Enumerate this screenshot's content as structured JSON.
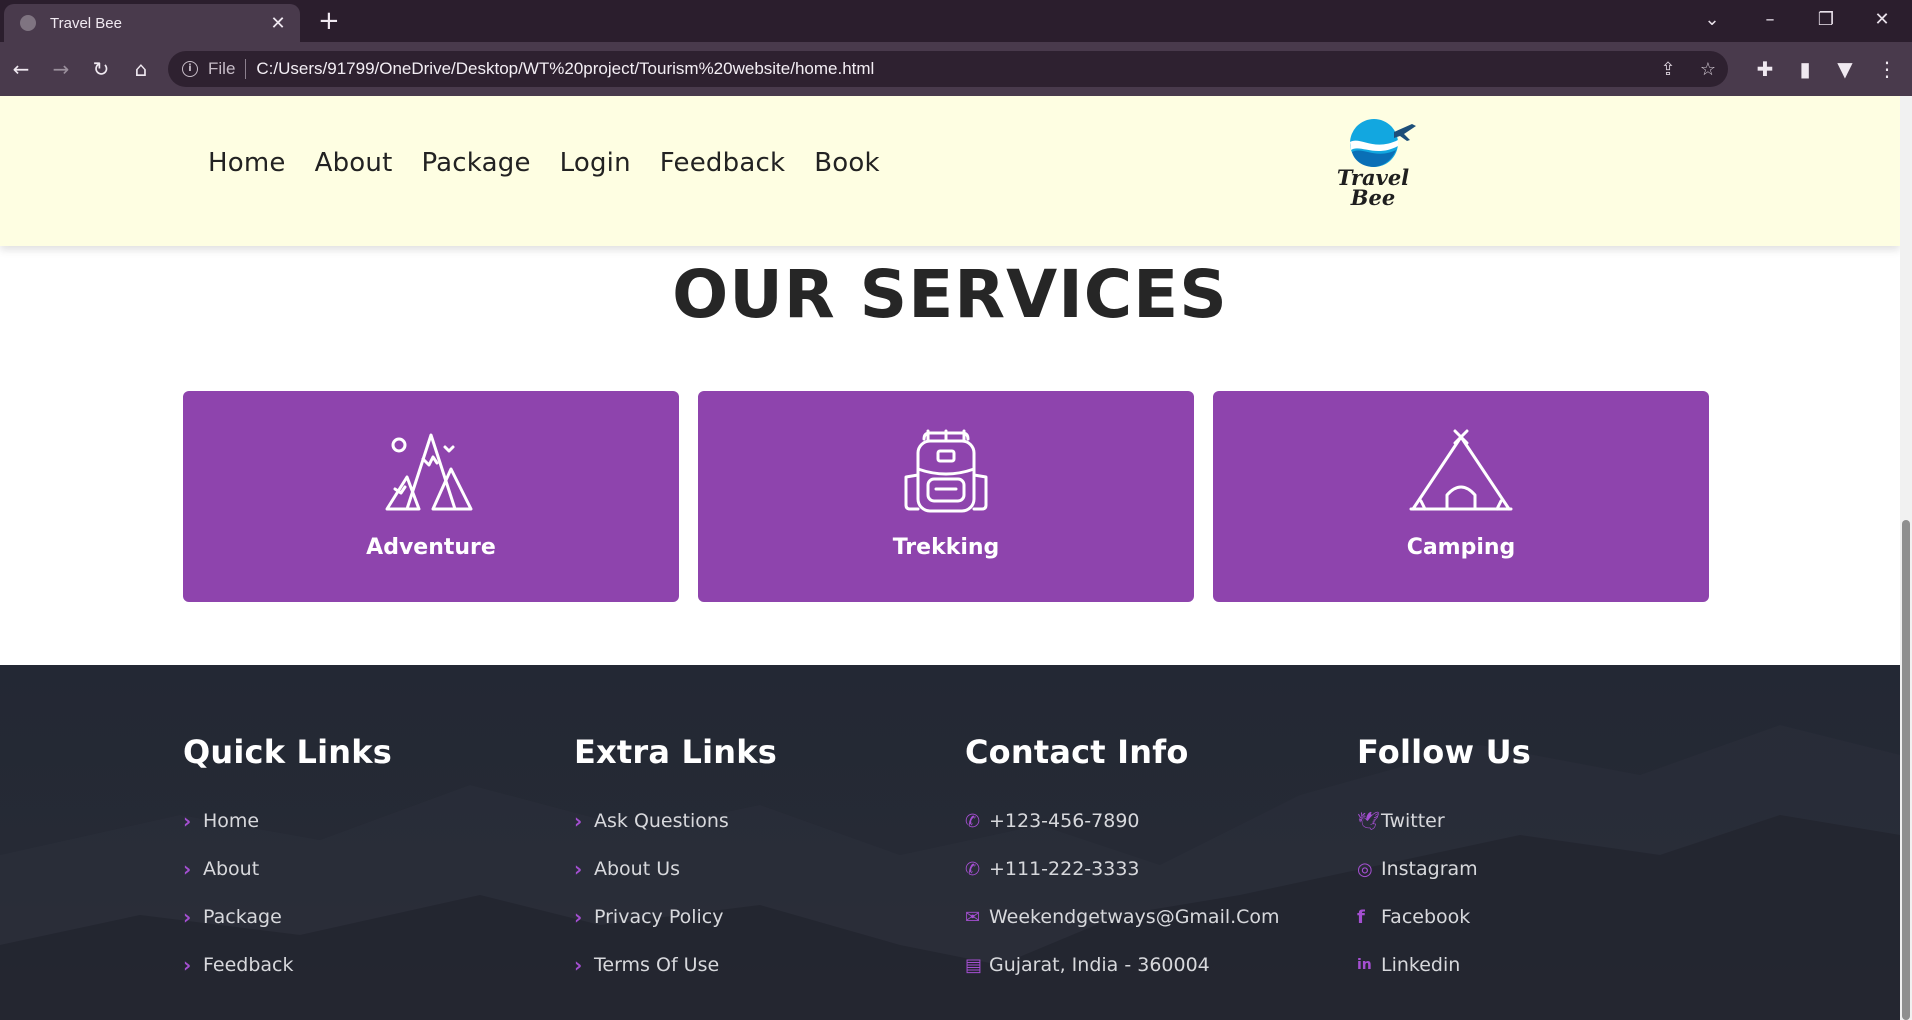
{
  "browser": {
    "tab_title": "Travel Bee",
    "url_scheme": "File",
    "url": "C:/Users/91799/OneDrive/Desktop/WT%20project/Tourism%20website/home.html"
  },
  "nav": {
    "items": [
      "Home",
      "About",
      "Package",
      "Login",
      "Feedback",
      "Book"
    ]
  },
  "logo": {
    "line1": "Travel",
    "line2": "Bee"
  },
  "services": {
    "title": "OUR SERVICES",
    "cards": [
      {
        "label": "Adventure",
        "icon": "mountains-icon"
      },
      {
        "label": "Trekking",
        "icon": "backpack-icon"
      },
      {
        "label": "Camping",
        "icon": "tent-icon"
      }
    ]
  },
  "footer": {
    "quick_links": {
      "title": "Quick Links",
      "items": [
        "Home",
        "About",
        "Package",
        "Feedback"
      ]
    },
    "extra_links": {
      "title": "Extra Links",
      "items": [
        "Ask Questions",
        "About Us",
        "Privacy Policy",
        "Terms Of Use"
      ]
    },
    "contact": {
      "title": "Contact Info",
      "items": [
        {
          "text": "+123-456-7890",
          "icon": "phone-icon"
        },
        {
          "text": "+111-222-3333",
          "icon": "phone-icon"
        },
        {
          "text": "Weekendgetways@Gmail.Com",
          "icon": "envelope-icon"
        },
        {
          "text": "Gujarat, India - 360004",
          "icon": "map-icon"
        }
      ]
    },
    "follow": {
      "title": "Follow Us",
      "items": [
        {
          "text": "Twitter",
          "icon": "twitter-icon"
        },
        {
          "text": "Instagram",
          "icon": "instagram-icon"
        },
        {
          "text": "Facebook",
          "icon": "facebook-icon"
        },
        {
          "text": "Linkedin",
          "icon": "linkedin-icon"
        }
      ]
    }
  },
  "colors": {
    "header_bg": "#fefee2",
    "card_bg": "#8e44ad",
    "accent": "#a44fd1",
    "footer_bg": "#232834"
  }
}
